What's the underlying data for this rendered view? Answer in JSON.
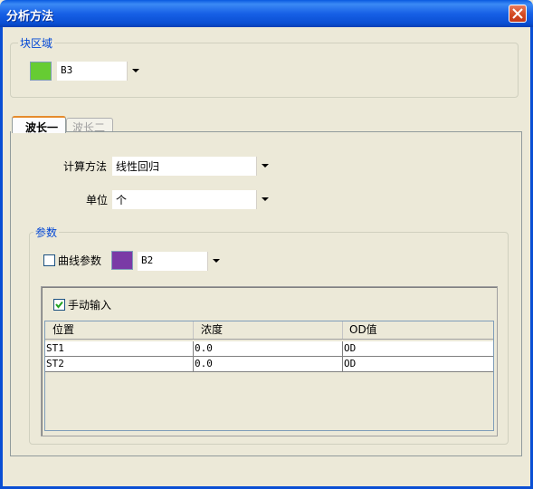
{
  "window": {
    "title": "分析方法"
  },
  "block_group": {
    "legend": "块区域",
    "color": "#66cc33",
    "selected": "B3"
  },
  "tabs": [
    {
      "label": "波长一",
      "active": true
    },
    {
      "label": "波长二",
      "active": false
    }
  ],
  "calc_method": {
    "label": "计算方法",
    "value": "线性回归"
  },
  "unit": {
    "label": "单位",
    "value": "个"
  },
  "params": {
    "legend": "参数",
    "curve_params": {
      "label": "曲线参数",
      "checked": false
    },
    "curve_color": "#7a3aa6",
    "curve_select": "B2",
    "manual_input": {
      "label": "手动输入",
      "checked": true
    }
  },
  "table": {
    "columns": [
      "位置",
      "浓度",
      "OD值"
    ],
    "rows": [
      [
        "ST1",
        "0.0",
        "OD"
      ],
      [
        "ST2",
        "0.0",
        "OD"
      ]
    ]
  }
}
